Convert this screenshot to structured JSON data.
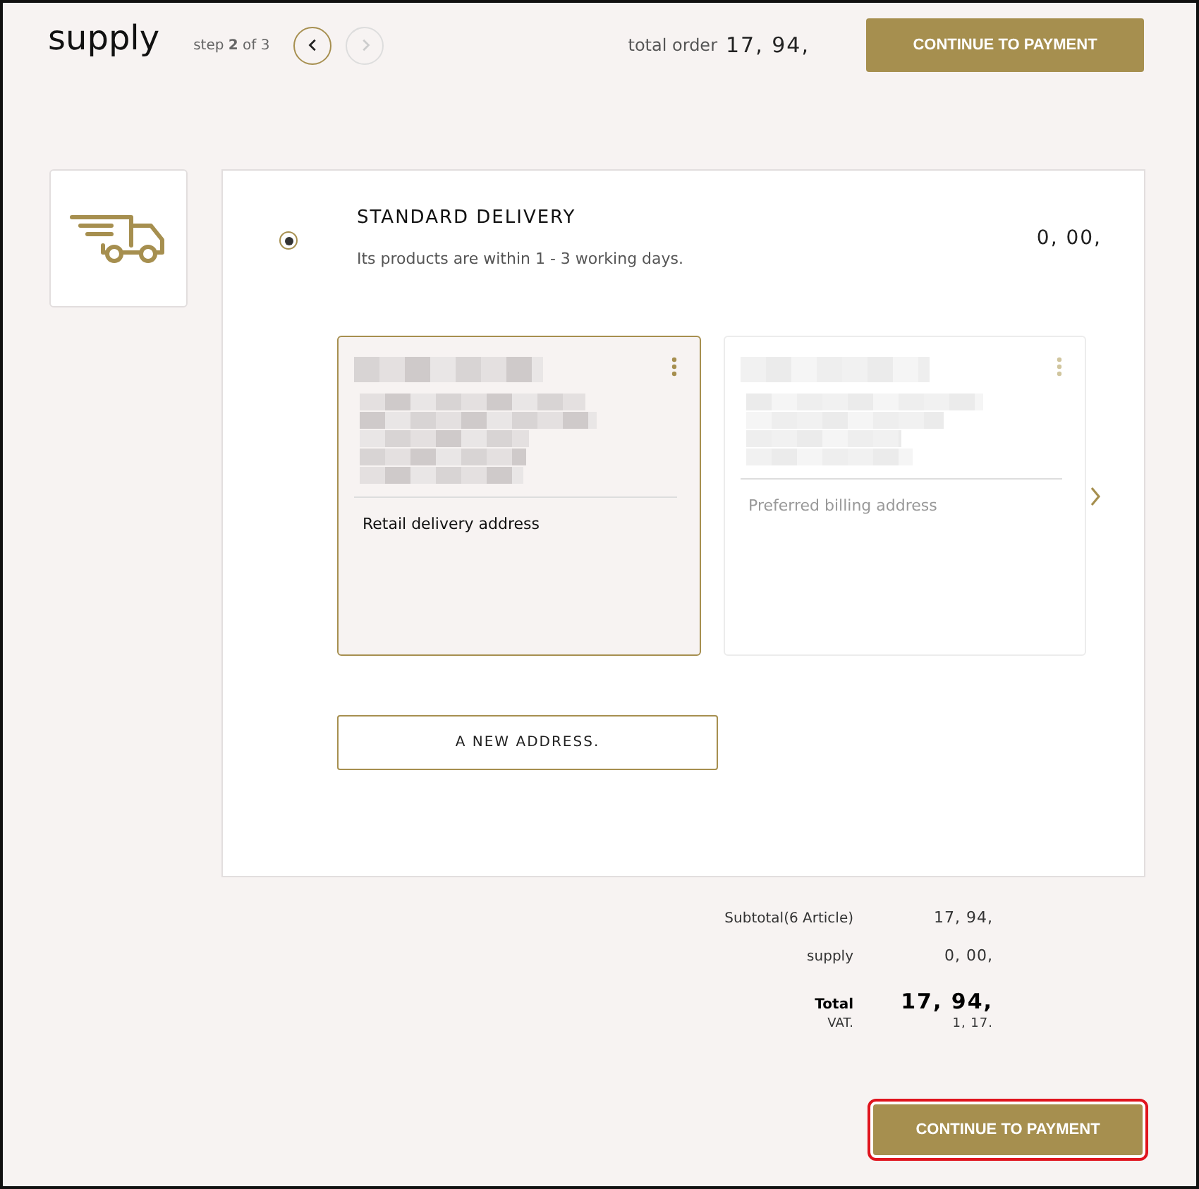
{
  "header": {
    "title": "supply",
    "step": "step **2** of 3",
    "nav": [
      {
        "kind": "prev",
        "disabled": false
      },
      {
        "kind": "next",
        "disabled": true
      }
    ],
    "total_label": "total order",
    "total_value": "17, 94,",
    "button": "CONTINUE TO PAYMENT"
  },
  "delivery": {
    "selected": true,
    "title": "STANDARD DELIVERY",
    "description": "Its products are within 1 - 3 working days.",
    "price": "0, 00,",
    "addresses": [
      {
        "label": "Retail delivery address",
        "selected": true
      },
      {
        "label": "Preferred billing address",
        "selected": false
      }
    ],
    "new_address_button": "A NEW ADDRESS."
  },
  "summary": [
    {
      "kind": "normal",
      "label": "Subtotal(6 Article)",
      "value": "17, 94,"
    },
    {
      "kind": "normal",
      "label": "supply",
      "value": "0, 00,"
    },
    {
      "kind": "total",
      "label": "Total",
      "value": "17, 94,"
    },
    {
      "kind": "vat",
      "label": "VAT.",
      "value": "1, 17."
    }
  ],
  "footer_button": {
    "label": "CONTINUE TO PAYMENT",
    "highlighted": true
  }
}
